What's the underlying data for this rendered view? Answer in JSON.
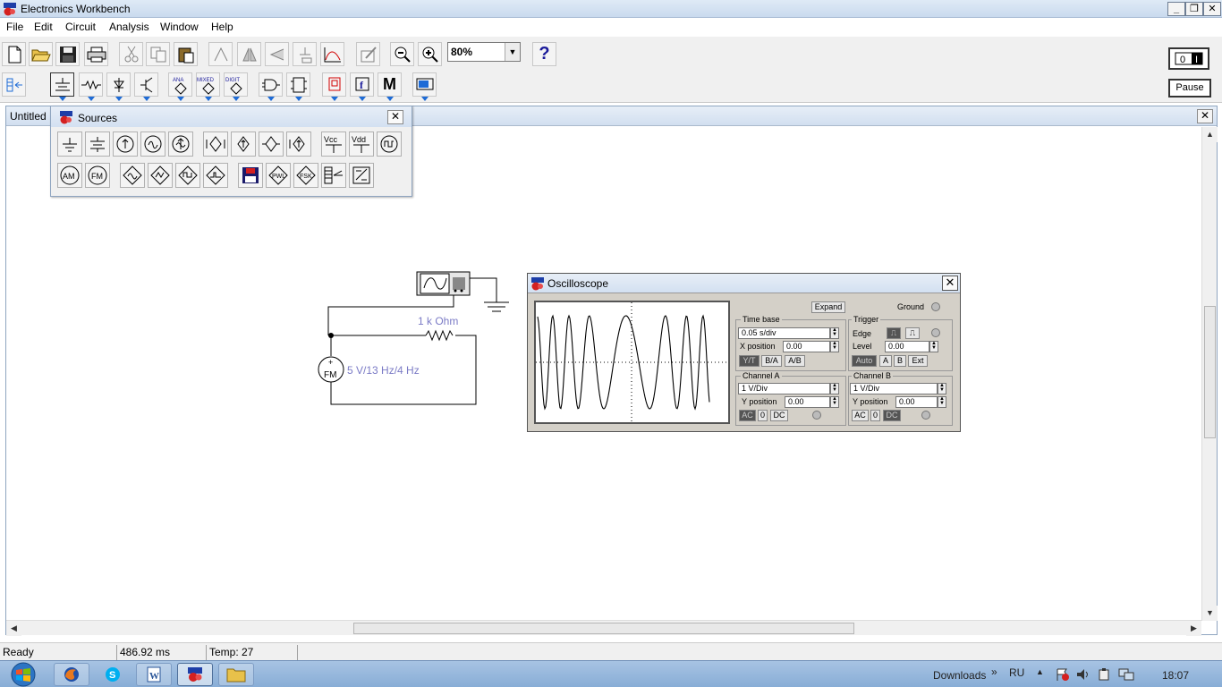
{
  "window": {
    "title": "Electronics Workbench"
  },
  "menu": [
    "File",
    "Edit",
    "Circuit",
    "Analysis",
    "Window",
    "Help"
  ],
  "toolbar": {
    "zoom": "80%",
    "help": "?",
    "pause_label": "Pause",
    "power_label": "0 I",
    "parts_labels": {
      "analog": "ANA",
      "mixed": "MIXED",
      "digital": "DIGIT",
      "misc": "M",
      "fx": "f"
    }
  },
  "document": {
    "title": "Untitled"
  },
  "sources_palette": {
    "title": "Sources",
    "labels": {
      "vcc": "Vcc",
      "vdd": "Vdd",
      "am": "AM",
      "fm": "FM",
      "pwl": "PWL",
      "fsk": "FSK"
    }
  },
  "circuit": {
    "resistor_label": "1 k Ohm",
    "source_label": "5 V/13 Hz/4 Hz",
    "source_symbol": "FM",
    "source_plus": "+"
  },
  "oscilloscope": {
    "title": "Oscilloscope",
    "expand": "Expand",
    "ground": "Ground",
    "time_base": {
      "label": "Time base",
      "value": "0.05 s/div",
      "xpos_label": "X position",
      "xpos_value": "0.00",
      "modes": [
        "Y/T",
        "B/A",
        "A/B"
      ]
    },
    "trigger": {
      "label": "Trigger",
      "edge_label": "Edge",
      "level_label": "Level",
      "level_value": "0.00",
      "sources": [
        "Auto",
        "A",
        "B",
        "Ext"
      ]
    },
    "channel_a": {
      "label": "Channel A",
      "value": "1  V/Div",
      "ypos_label": "Y position",
      "ypos_value": "0.00",
      "coupling": [
        "AC",
        "0",
        "DC"
      ]
    },
    "channel_b": {
      "label": "Channel B",
      "value": "1  V/Div",
      "ypos_label": "Y position",
      "ypos_value": "0.00",
      "coupling": [
        "AC",
        "0",
        "DC"
      ]
    }
  },
  "status": {
    "ready": "Ready",
    "time": "486.92 ms",
    "temp": "Temp:  27"
  },
  "taskbar": {
    "downloads": "Downloads",
    "lang": "RU",
    "clock": "18:07",
    "double_chevron": "»"
  },
  "colors": {
    "title_bar": "#c9daee",
    "taskbar": "#88add6",
    "label_blue": "#7b7bc6",
    "drop_arrow": "#1e6bd6"
  }
}
